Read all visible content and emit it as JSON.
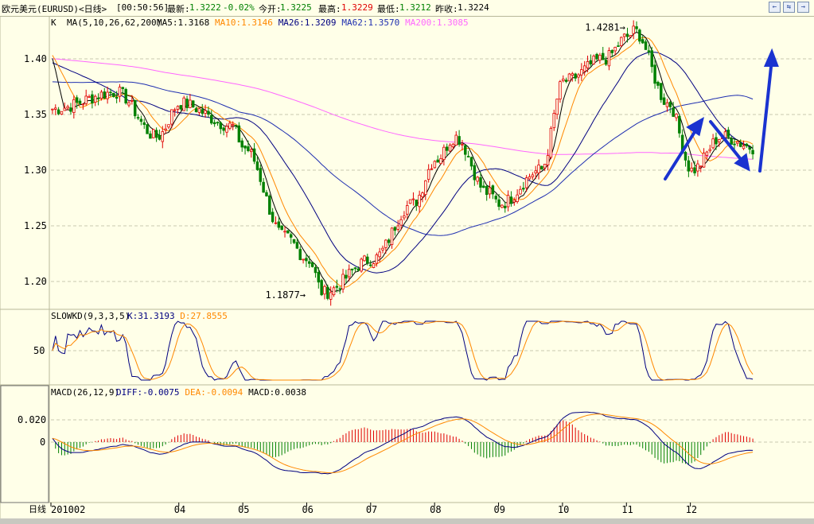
{
  "header": {
    "instrument": "欧元美元(EURUSD)<日线>",
    "time": "[00:50:56]",
    "latest_label": "最新:",
    "latest_value": "1.3222",
    "change": "-0.02%",
    "open_label": "今开:",
    "open_value": "1.3225",
    "high_label": "最高:",
    "high_value": "1.3229",
    "low_label": "最低:",
    "low_value": "1.3212",
    "prev_label": "昨收:",
    "prev_value": "1.3224",
    "buttons": [
      "←",
      "⇆",
      "→"
    ]
  },
  "colors": {
    "background": "#ffffe8",
    "up": "#e00000",
    "down": "#008000",
    "ma5": "#000000",
    "ma10": "#ff8800",
    "ma26": "#000080",
    "ma62": "#1f2fb0",
    "ma200": "#ff66ff",
    "annotation": "#1a33d0"
  },
  "chart_data": [
    {
      "type": "candlestick",
      "title": "K",
      "indicator_label": "MA(5,10,26,62,200)",
      "legend": [
        {
          "name": "MA5",
          "value": "1.3168",
          "color": "#000000"
        },
        {
          "name": "MA10",
          "value": "1.3146",
          "color": "#ff8800"
        },
        {
          "name": "MA26",
          "value": "1.3209",
          "color": "#000080"
        },
        {
          "name": "MA62",
          "value": "1.3570",
          "color": "#1f2fb0"
        },
        {
          "name": "MA200",
          "value": "1.3085",
          "color": "#ff66ff"
        }
      ],
      "y_ticks": [
        "1.20",
        "1.25",
        "1.30",
        "1.35",
        "1.40"
      ],
      "ylim": [
        1.18,
        1.435
      ],
      "x_ticks": [
        "2010-02",
        "04",
        "05",
        "06",
        "07",
        "08",
        "09",
        "10",
        "11",
        "12"
      ],
      "annotations": [
        {
          "text": "1.4281",
          "value": 1.4281,
          "at": "2010-11"
        },
        {
          "text": "1.1877",
          "value": 1.1877,
          "at": "2010-06"
        }
      ],
      "price_anchors": [
        [
          "2010-02",
          1.355
        ],
        [
          "2010-03",
          1.37
        ],
        [
          "2010-03-20",
          1.33
        ],
        [
          "2010-04",
          1.36
        ],
        [
          "2010-04-25",
          1.34
        ],
        [
          "2010-05",
          1.32
        ],
        [
          "2010-05-20",
          1.24
        ],
        [
          "2010-06",
          1.22
        ],
        [
          "2010-06-08",
          1.19
        ],
        [
          "2010-07",
          1.22
        ],
        [
          "2010-07-20",
          1.27
        ],
        [
          "2010-08",
          1.31
        ],
        [
          "2010-08-10",
          1.33
        ],
        [
          "2010-08-25",
          1.28
        ],
        [
          "2010-09",
          1.27
        ],
        [
          "2010-09-20",
          1.3
        ],
        [
          "2010-10",
          1.38
        ],
        [
          "2010-10-20",
          1.4
        ],
        [
          "2010-11",
          1.42
        ],
        [
          "2010-11-04",
          1.425
        ],
        [
          "2010-11-20",
          1.36
        ],
        [
          "2010-12",
          1.3
        ],
        [
          "2010-12-15",
          1.33
        ],
        [
          "2010-12-31",
          1.32
        ]
      ],
      "grid": true
    },
    {
      "type": "line",
      "title": "SLOWKD(9,3,3,5)",
      "legend": [
        {
          "name": "K",
          "value": "31.3193",
          "color": "#000080"
        },
        {
          "name": "D",
          "value": "27.8555",
          "color": "#ff8800"
        }
      ],
      "y_ticks": [
        "50"
      ],
      "ylim": [
        0,
        100
      ]
    },
    {
      "type": "bar",
      "title": "MACD(26,12,9)",
      "legend": [
        {
          "name": "DIFF",
          "value": "-0.0075",
          "color": "#000080"
        },
        {
          "name": "DEA",
          "value": "-0.0094",
          "color": "#ff8800"
        },
        {
          "name": "MACD",
          "value": "0.0038",
          "color": "#000000"
        }
      ],
      "y_ticks": [
        "0.020",
        "0"
      ],
      "ylim": [
        -0.05,
        0.04
      ]
    }
  ],
  "footer": {
    "period_label": "日线",
    "first_tick": "201002"
  }
}
